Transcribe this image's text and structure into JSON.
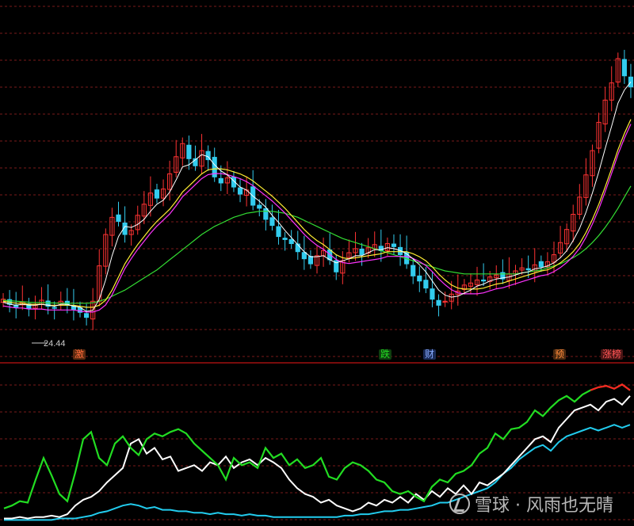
{
  "chart_data": {
    "type": "line",
    "description_kind": "stock candlestick chart with moving averages and indicator panel",
    "low_label": "24.44",
    "tags": [
      {
        "text": "激",
        "color": "#ff6a3a",
        "bg": "#5a2a10",
        "x_index": 0.115
      },
      {
        "text": "跌",
        "color": "#22dd22",
        "bg": "#0f3f0f",
        "x_index": 0.598
      },
      {
        "text": "财",
        "color": "#88aaff",
        "bg": "#1a2a55",
        "x_index": 0.668
      },
      {
        "text": "预",
        "color": "#ff8a3a",
        "bg": "#4a2a10",
        "x_index": 0.872
      },
      {
        "text": "涨榜",
        "color": "#ff5555",
        "bg": "#4a1515",
        "x_index": 0.947
      }
    ],
    "price_series": {
      "close": [
        27.1,
        26.6,
        26.3,
        26.8,
        26.2,
        26.5,
        27.0,
        26.4,
        26.2,
        26.9,
        26.5,
        26.1,
        25.8,
        25.3,
        26.9,
        30.4,
        33.5,
        35.2,
        34.8,
        33.5,
        33.9,
        35.4,
        36.5,
        37.6,
        37.1,
        38.0,
        39.5,
        41.2,
        42.5,
        41.0,
        40.3,
        41.8,
        40.9,
        39.2,
        38.6,
        39.1,
        38.2,
        37.5,
        37.9,
        36.4,
        36.1,
        35.0,
        34.4,
        33.3,
        33.0,
        32.6,
        31.8,
        31.1,
        30.6,
        31.4,
        31.9,
        31.0,
        29.8,
        30.9,
        31.7,
        32.1,
        31.5,
        32.2,
        32.5,
        31.9,
        32.6,
        32.3,
        31.5,
        30.6,
        29.4,
        28.9,
        28.2,
        27.1,
        26.5,
        26.9,
        27.6,
        27.9,
        28.5,
        28.7,
        29.0,
        28.9,
        29.3,
        29.5,
        29.1,
        29.6,
        29.9,
        30.2,
        30.0,
        30.5,
        30.3,
        30.8,
        31.5,
        32.7,
        34.0,
        35.5,
        37.2,
        39.4,
        41.8,
        44.6,
        46.8,
        48.5,
        50.9,
        49.2,
        48.1
      ],
      "ma5": [
        26.8,
        26.6,
        26.5,
        26.6,
        26.5,
        26.5,
        26.6,
        26.5,
        26.4,
        26.6,
        26.6,
        26.4,
        26.3,
        25.9,
        26.0,
        27.1,
        29.0,
        31.4,
        33.3,
        34.3,
        34.2,
        34.5,
        35.0,
        35.8,
        36.5,
        36.9,
        37.7,
        38.9,
        40.2,
        40.4,
        40.9,
        41.4,
        41.2,
        40.4,
        39.8,
        39.4,
        38.8,
        38.2,
        37.9,
        37.3,
        36.8,
        36.2,
        35.4,
        34.7,
        33.9,
        33.2,
        32.5,
        31.8,
        31.3,
        31.3,
        31.4,
        31.0,
        30.7,
        30.9,
        31.1,
        31.4,
        31.4,
        31.7,
        32.0,
        32.0,
        32.2,
        32.1,
        31.9,
        31.6,
        31.1,
        30.5,
        29.8,
        28.9,
        28.0,
        27.5,
        27.3,
        27.4,
        27.7,
        28.0,
        28.4,
        28.6,
        28.9,
        29.1,
        29.2,
        29.3,
        29.5,
        29.7,
        29.8,
        30.1,
        30.2,
        30.4,
        30.7,
        31.2,
        31.9,
        32.9,
        34.1,
        35.7,
        37.6,
        39.7,
        42.0,
        44.2,
        46.5,
        47.8,
        48.6
      ],
      "ma10": [
        26.9,
        26.8,
        26.7,
        26.7,
        26.6,
        26.6,
        26.6,
        26.5,
        26.5,
        26.5,
        26.5,
        26.5,
        26.4,
        26.3,
        26.3,
        26.5,
        27.0,
        28.0,
        29.3,
        30.6,
        31.6,
        32.5,
        33.3,
        34.1,
        34.8,
        35.4,
        36.0,
        36.8,
        37.7,
        38.3,
        38.9,
        39.5,
        39.9,
        40.0,
        40.0,
        39.9,
        39.7,
        39.5,
        39.2,
        38.8,
        38.3,
        37.8,
        37.3,
        36.7,
        36.1,
        35.4,
        34.7,
        34.0,
        33.4,
        32.9,
        32.5,
        32.0,
        31.5,
        31.2,
        31.1,
        31.2,
        31.3,
        31.4,
        31.5,
        31.6,
        31.8,
        31.8,
        31.8,
        31.8,
        31.6,
        31.3,
        30.9,
        30.3,
        29.6,
        29.0,
        28.5,
        28.2,
        28.1,
        28.1,
        28.1,
        28.2,
        28.4,
        28.6,
        28.7,
        28.9,
        29.1,
        29.3,
        29.5,
        29.7,
        29.9,
        30.0,
        30.3,
        30.7,
        31.2,
        31.8,
        32.6,
        33.7,
        35.0,
        36.5,
        38.2,
        40.0,
        41.9,
        43.5,
        44.9
      ],
      "ma60": [
        27.0,
        26.95,
        26.9,
        26.85,
        26.8,
        26.78,
        26.76,
        26.74,
        26.72,
        26.7,
        26.7,
        26.7,
        26.7,
        26.7,
        26.75,
        26.9,
        27.1,
        27.4,
        27.7,
        28.0,
        28.4,
        28.8,
        29.2,
        29.6,
        30.0,
        30.5,
        31.0,
        31.5,
        32.0,
        32.5,
        33.0,
        33.5,
        33.9,
        34.3,
        34.6,
        34.9,
        35.2,
        35.4,
        35.6,
        35.7,
        35.8,
        35.8,
        35.8,
        35.7,
        35.6,
        35.4,
        35.2,
        34.9,
        34.6,
        34.3,
        34.0,
        33.7,
        33.4,
        33.1,
        32.9,
        32.7,
        32.5,
        32.3,
        32.1,
        31.9,
        31.7,
        31.5,
        31.3,
        31.1,
        30.9,
        30.7,
        30.5,
        30.3,
        30.1,
        29.9,
        29.8,
        29.7,
        29.6,
        29.6,
        29.6,
        29.6,
        29.6,
        29.6,
        29.6,
        29.6,
        29.6,
        29.7,
        29.8,
        29.9,
        30.0,
        30.2,
        30.4,
        30.6,
        30.9,
        31.2,
        31.6,
        32.1,
        32.7,
        33.4,
        34.2,
        35.1,
        36.1,
        37.2,
        38.3
      ]
    },
    "indicator_series": {
      "green": [
        10,
        12,
        15,
        14,
        30,
        45,
        33,
        20,
        15,
        35,
        58,
        63,
        45,
        40,
        55,
        60,
        52,
        47,
        58,
        62,
        60,
        63,
        65,
        62,
        55,
        50,
        45,
        40,
        30,
        45,
        40,
        42,
        38,
        52,
        45,
        48,
        40,
        44,
        38,
        40,
        45,
        32,
        30,
        38,
        42,
        40,
        36,
        30,
        28,
        22,
        20,
        22,
        18,
        15,
        25,
        30,
        28,
        34,
        36,
        40,
        48,
        52,
        62,
        58,
        65,
        66,
        70,
        78,
        74,
        80,
        85,
        88,
        84,
        89,
        92,
        94,
        95,
        93,
        96,
        92
      ],
      "white": [
        3,
        3,
        4,
        3,
        4,
        4,
        5,
        4,
        6,
        12,
        16,
        18,
        22,
        28,
        33,
        38,
        55,
        58,
        48,
        52,
        44,
        46,
        36,
        38,
        40,
        36,
        42,
        40,
        46,
        38,
        42,
        44,
        40,
        45,
        42,
        38,
        30,
        24,
        20,
        18,
        14,
        16,
        12,
        10,
        8,
        10,
        14,
        12,
        16,
        14,
        18,
        14,
        20,
        16,
        22,
        18,
        24,
        20,
        26,
        20,
        28,
        26,
        30,
        34,
        40,
        46,
        52,
        58,
        60,
        56,
        66,
        72,
        78,
        80,
        82,
        78,
        84,
        86,
        82,
        88
      ],
      "cyan": [
        2,
        2,
        2,
        2,
        2,
        2,
        2,
        3,
        3,
        3,
        4,
        5,
        7,
        8,
        10,
        12,
        13,
        12,
        10,
        11,
        9,
        9,
        8,
        8,
        7,
        7,
        6,
        7,
        6,
        6,
        5,
        6,
        5,
        5,
        4,
        4,
        4,
        4,
        4,
        4,
        4,
        4,
        4,
        5,
        5,
        6,
        6,
        7,
        8,
        8,
        9,
        9,
        10,
        11,
        12,
        14,
        14,
        16,
        18,
        20,
        22,
        24,
        28,
        34,
        38,
        44,
        48,
        52,
        54,
        50,
        56,
        60,
        62,
        64,
        66,
        64,
        66,
        68,
        66,
        68
      ]
    },
    "price_range": [
      23.0,
      52.0
    ],
    "indicator_range": [
      0,
      100
    ]
  },
  "watermark": {
    "text": "雪球 · 风雨也无晴",
    "icon": "xueqiu-logo-icon"
  },
  "colors": {
    "up": "#ff3333",
    "down": "#33ccee",
    "ma5": "#ffffff",
    "ma10": "#ffee33",
    "ma20": "#ff33ff",
    "ma60": "#33dd33",
    "grid": "#7a1a1a",
    "separator": "#a01010"
  }
}
